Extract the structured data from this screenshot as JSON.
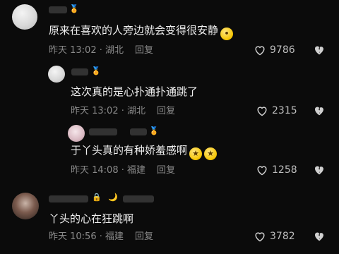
{
  "comments": [
    {
      "text": "原来在喜欢的人旁边就会变得很安静",
      "emoji": [
        "😶"
      ],
      "time": "昨天 13:02",
      "location": "湖北",
      "reply_label": "回复",
      "likes": "9786"
    },
    {
      "text": "这次真的是心扑通扑通跳了",
      "emoji": [],
      "time": "昨天 13:02",
      "location": "湖北",
      "reply_label": "回复",
      "likes": "2315"
    },
    {
      "text": "于丫头真的有种娇羞感啊",
      "emoji": [
        "🤩",
        "🤩"
      ],
      "time": "昨天 14:08",
      "location": "福建",
      "reply_label": "回复",
      "likes": "1258"
    },
    {
      "text": "丫头的心在狂跳啊",
      "emoji": [],
      "time": "昨天 10:56",
      "location": "福建",
      "reply_label": "回复",
      "likes": "3782"
    }
  ],
  "icons": {
    "like": "heart-outline-icon",
    "dislike": "broken-heart-icon",
    "badge": "crown-badge-icon"
  },
  "colors": {
    "background": "#0b0b0b",
    "text": "#f0f0f0",
    "meta": "#8a8a8a"
  }
}
